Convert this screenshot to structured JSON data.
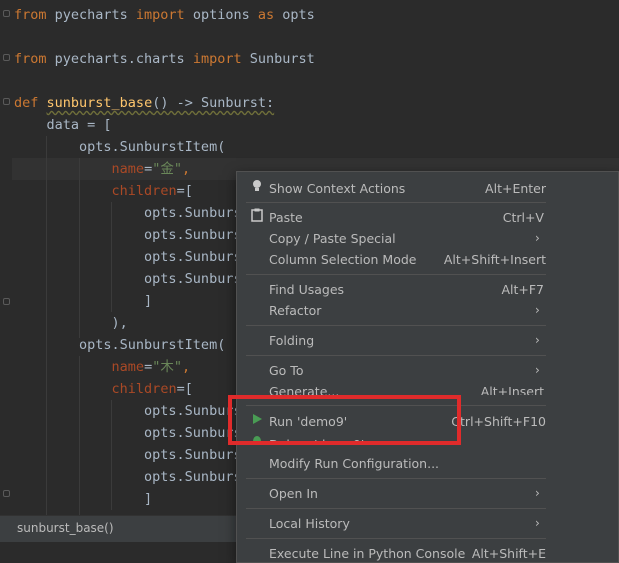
{
  "code": {
    "line1": {
      "kw1": "from",
      "mod": " pyecharts ",
      "kw2": "import",
      "rest": " options ",
      "kw3": "as",
      "alias": " opts"
    },
    "line2": {
      "kw1": "from",
      "mod": " pyecharts.charts ",
      "kw2": "import",
      "rest": " Sunburst"
    },
    "line3": {
      "kw": "def",
      "fn": "sunburst_base",
      "rest": "() -> Sunburst:"
    },
    "line4": "    data = [",
    "line5": "        opts.SunburstItem(",
    "line6": {
      "indent": "            ",
      "param": "name",
      "eq": "=",
      "str": "\"金\"",
      "comma": ","
    },
    "line7": {
      "indent": "            ",
      "param": "children",
      "rest": "=["
    },
    "line8": "                opts.Sunburs",
    "line9": "                opts.Sunburs",
    "line10": "                opts.Sunburs",
    "line11": "                opts.Sunburs",
    "line12": "                ]",
    "line13": "            ),",
    "line14": "        opts.SunburstItem(",
    "line15": {
      "indent": "            ",
      "param": "name",
      "eq": "=",
      "str": "\"木\"",
      "comma": ","
    },
    "line16": {
      "indent": "            ",
      "param": "children",
      "rest": "=["
    },
    "line17": "                opts.Sunburs",
    "line18": "                opts.Sunburs",
    "line19": "                opts.Sunburs",
    "line20": "                opts.Sunburs",
    "line21": "                ]"
  },
  "breadcrumb": "sunburst_base()",
  "menu": {
    "show_context_actions": {
      "label": "Show Context Actions",
      "shortcut": "Alt+Enter"
    },
    "paste": {
      "label": "Paste",
      "shortcut": "Ctrl+V"
    },
    "copy_paste_special": {
      "label": "Copy / Paste Special",
      "arrow": "›"
    },
    "column_selection_mode": {
      "label": "Column Selection Mode",
      "shortcut": "Alt+Shift+Insert"
    },
    "find_usages": {
      "label": "Find Usages",
      "shortcut": "Alt+F7"
    },
    "refactor": {
      "label": "Refactor",
      "arrow": "›"
    },
    "folding": {
      "label": "Folding",
      "arrow": "›"
    },
    "go_to": {
      "label": "Go To",
      "arrow": "›"
    },
    "generate": {
      "label": "Generate...",
      "shortcut": "Alt+Insert"
    },
    "run": {
      "label": "Run 'demo9'",
      "shortcut": "Ctrl+Shift+F10"
    },
    "debug": {
      "label": "Debug 'demo9'"
    },
    "modify_run_config": {
      "label": "Modify Run Configuration..."
    },
    "open_in": {
      "label": "Open In",
      "arrow": "›"
    },
    "local_history": {
      "label": "Local History",
      "arrow": "›"
    },
    "execute_line": {
      "label": "Execute Line in Python Console",
      "shortcut": "Alt+Shift+E"
    }
  },
  "icons": {
    "bulb": "lightbulb-icon",
    "paste": "clipboard-icon",
    "run": "run-triangle-icon",
    "debug": "bug-icon"
  },
  "colors": {
    "highlight_box": "#e02b2b",
    "run_green": "#499c54"
  }
}
